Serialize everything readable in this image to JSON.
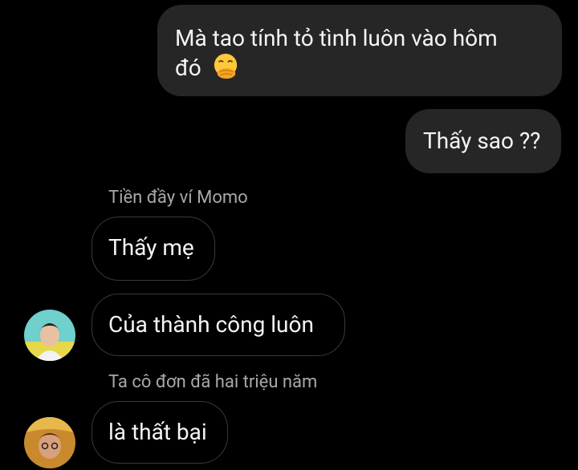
{
  "messages": {
    "sent_1": {
      "line1": "Mà tao tính tỏ tình luôn vào hôm",
      "line2": "đó",
      "emoji": "hand-over-mouth-emoji"
    },
    "sent_2": {
      "text": "Thấy sao ??"
    },
    "sender_1": "Tiền đầy ví Momo",
    "recv_1": {
      "text": "Thấy mẹ"
    },
    "recv_2": {
      "text": "Của thành công luôn"
    },
    "sender_2": "Ta cô đơn đã hai triệu năm",
    "recv_3": {
      "text": "là thất bại"
    }
  },
  "colors": {
    "background": "#000000",
    "sent_bubble": "#262626",
    "recv_border": "#3a3a3a",
    "sender_name": "#a8a8a8"
  }
}
